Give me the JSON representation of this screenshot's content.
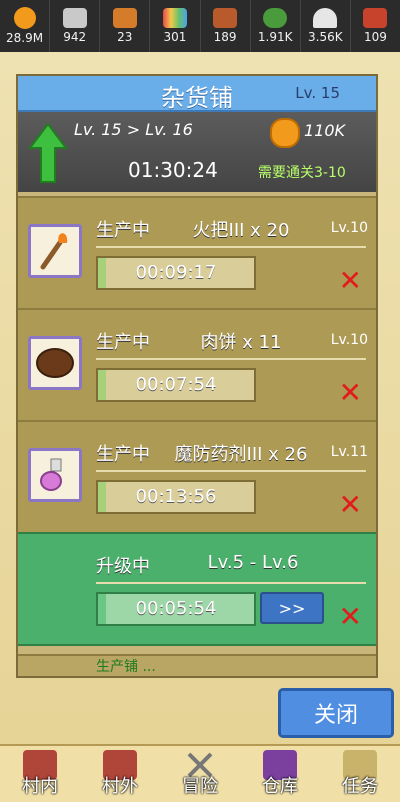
{
  "resources": [
    {
      "icon": "coin-icon",
      "value": "28.9M",
      "color": "#f29a1b"
    },
    {
      "icon": "iron-ingot-icon",
      "value": "942",
      "color": "#c9c9c9"
    },
    {
      "icon": "wood-plank-icon",
      "value": "23",
      "color": "#d57c2b"
    },
    {
      "icon": "rainbow-bar-icon",
      "value": "301",
      "color": "#68c06c"
    },
    {
      "icon": "leather-icon",
      "value": "189",
      "color": "#b85a2b"
    },
    {
      "icon": "herb-icon",
      "value": "1.91K",
      "color": "#4a9b3b"
    },
    {
      "icon": "salt-pile-icon",
      "value": "3.56K",
      "color": "#e6e6e6"
    },
    {
      "icon": "book-icon",
      "value": "109",
      "color": "#c8432b"
    }
  ],
  "shop": {
    "name": "杂货铺",
    "level_label": "Lv.   15",
    "upgrade": {
      "level_text": "Lv.  15    >  Lv.  16",
      "cost": "110K",
      "timer": "01:30:24",
      "requirement": "需要通关3-10"
    },
    "queue": [
      {
        "status": "生产中",
        "item": "火把III x 20",
        "level": "Lv.10",
        "time": "00:09:17",
        "progress": 0.05,
        "icon": "torch-icon"
      },
      {
        "status": "生产中",
        "item": "肉饼 x 11",
        "level": "Lv.10",
        "time": "00:07:54",
        "progress": 0.05,
        "icon": "meat-pie-icon"
      },
      {
        "status": "生产中",
        "item": "魔防药剂III x 26",
        "level": "Lv.11",
        "time": "00:13:56",
        "progress": 0.05,
        "icon": "potion-icon"
      }
    ],
    "upgrading": {
      "status": "升级中",
      "item": "Lv.5 - Lv.6",
      "time": "00:05:54",
      "progress": 0.05,
      "speedup": ">>"
    },
    "peek_text": "生产铺 ..."
  },
  "close_label": "关闭",
  "nav": [
    {
      "label": "村内",
      "icon": "village-inside-icon",
      "color": "#b0453a"
    },
    {
      "label": "村外",
      "icon": "village-outside-icon",
      "color": "#b0453a"
    },
    {
      "label": "冒险",
      "icon": "crossed-swords-icon",
      "color": "#8a8a8a"
    },
    {
      "label": "仓库",
      "icon": "warehouse-icon",
      "color": "#7b3f9e"
    },
    {
      "label": "任务",
      "icon": "quest-scroll-icon",
      "color": "#c9b36a"
    }
  ],
  "colors": {
    "title_bar": "#6aaee9",
    "cancel_x": "#e21b1b",
    "upgrade_row": "#4ab06b"
  }
}
